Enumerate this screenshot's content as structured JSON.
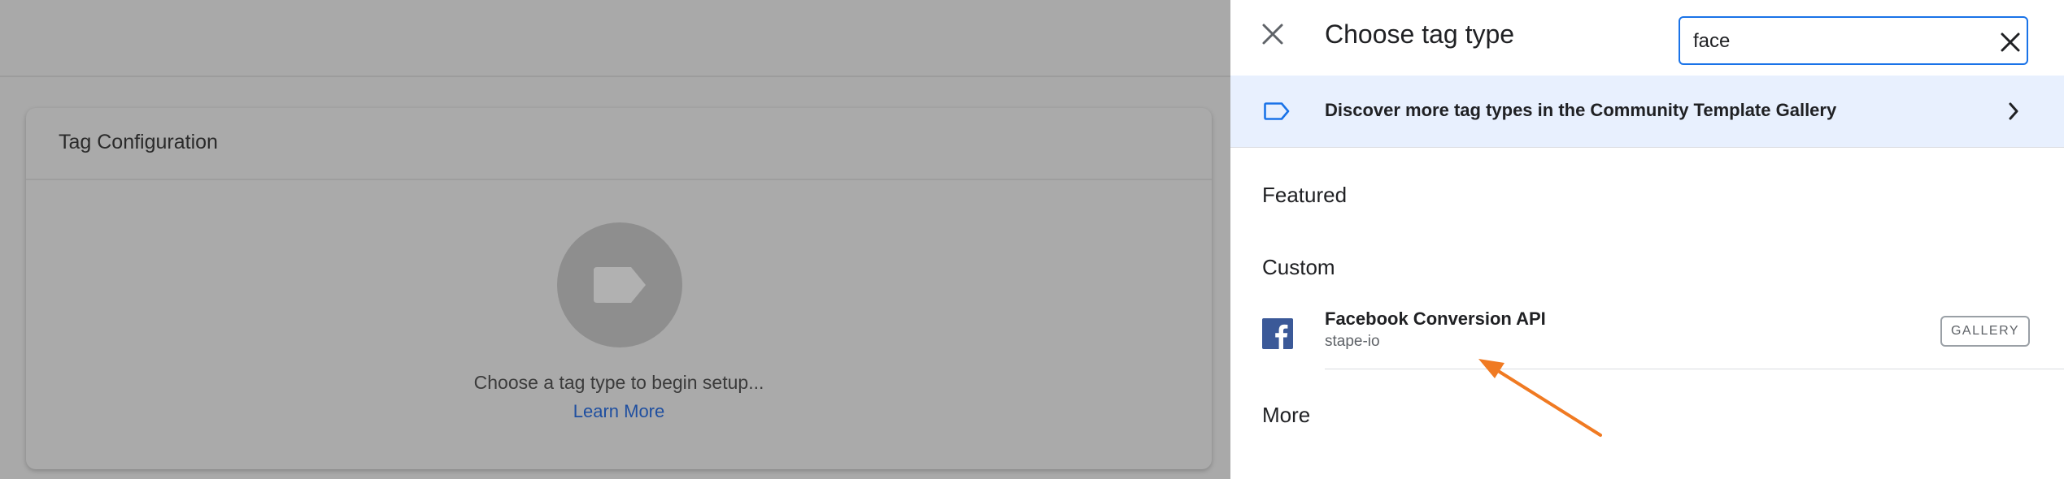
{
  "left_area": {
    "card": {
      "title": "Tag Configuration",
      "hint": "Choose a tag type to begin setup...",
      "learn_more": "Learn More"
    }
  },
  "panel": {
    "title": "Choose tag type",
    "search": {
      "value": "face"
    },
    "banner": {
      "text": "Discover more tag types in the Community Template Gallery"
    },
    "sections": {
      "featured": "Featured",
      "custom": "Custom",
      "more": "More"
    },
    "results": [
      {
        "name": "Facebook Conversion API",
        "publisher": "stape-io",
        "badge": "GALLERY"
      }
    ]
  },
  "icons": [
    "close-icon",
    "clear-search-icon",
    "tag-icon",
    "chevron-right-icon",
    "facebook-icon",
    "tag-placeholder-icon"
  ],
  "colors": {
    "accent_blue": "#1a73e8",
    "banner_bg": "#e8f0fe",
    "facebook_blue": "#3b5998",
    "annotation_arrow": "#f07a22",
    "overlay_gray": "#a9a9a9"
  }
}
